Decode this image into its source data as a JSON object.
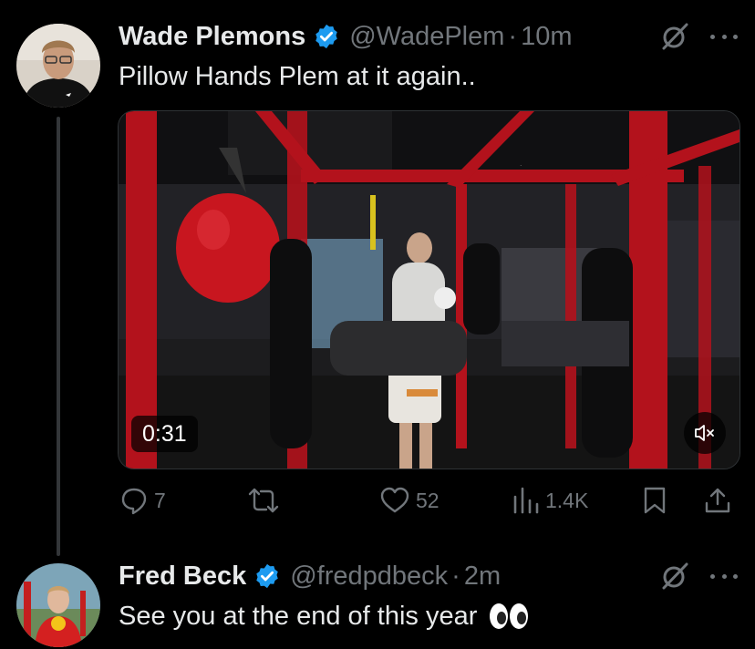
{
  "thread": [
    {
      "display_name": "Wade Plemons",
      "handle": "@WadePlem",
      "separator": "·",
      "time": "10m",
      "text": "Pillow Hands Plem at it again..",
      "media": {
        "type": "video",
        "duration": "0:31"
      },
      "actions": {
        "replies": "7",
        "reposts": "",
        "likes": "52",
        "views": "1.4K"
      }
    },
    {
      "display_name": "Fred Beck",
      "handle": "@fredpdbeck",
      "separator": "·",
      "time": "2m",
      "text": "See you at the end of this year",
      "emoji": "eyes"
    }
  ],
  "icons": {
    "verified": "verified-badge-icon",
    "grok": "grok-icon",
    "more": "more-options-icon",
    "reply": "reply-icon",
    "repost": "repost-icon",
    "like": "like-icon",
    "views": "views-icon",
    "bookmark": "bookmark-icon",
    "share": "share-icon",
    "mute": "mute-icon"
  },
  "colors": {
    "background": "#000000",
    "text_primary": "#e7e9ea",
    "text_secondary": "#71767b",
    "verified_blue": "#1d9bf0",
    "thread_line": "#333639"
  }
}
